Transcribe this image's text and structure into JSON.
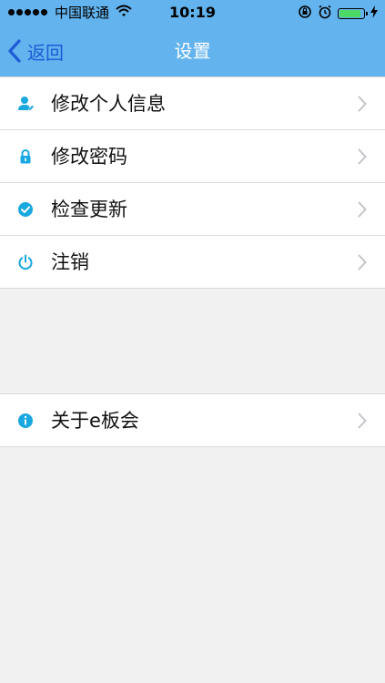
{
  "status_bar": {
    "carrier": "中国联通",
    "time": "10:19",
    "battery_level": 0.9
  },
  "nav": {
    "back_label": "返回",
    "title": "设置"
  },
  "groups": [
    {
      "items": [
        {
          "label": "修改个人信息",
          "icon": "user-edit-icon"
        },
        {
          "label": "修改密码",
          "icon": "lock-icon"
        },
        {
          "label": "检查更新",
          "icon": "check-circle-icon"
        },
        {
          "label": "注销",
          "icon": "power-icon"
        }
      ]
    },
    {
      "items": [
        {
          "label": "关于e板会",
          "icon": "info-icon"
        }
      ]
    }
  ],
  "colors": {
    "nav_background": "#63b3ee",
    "back_color": "#1d5bd6",
    "icon_color": "#1aa8e0",
    "page_background": "#f1f1f1"
  }
}
